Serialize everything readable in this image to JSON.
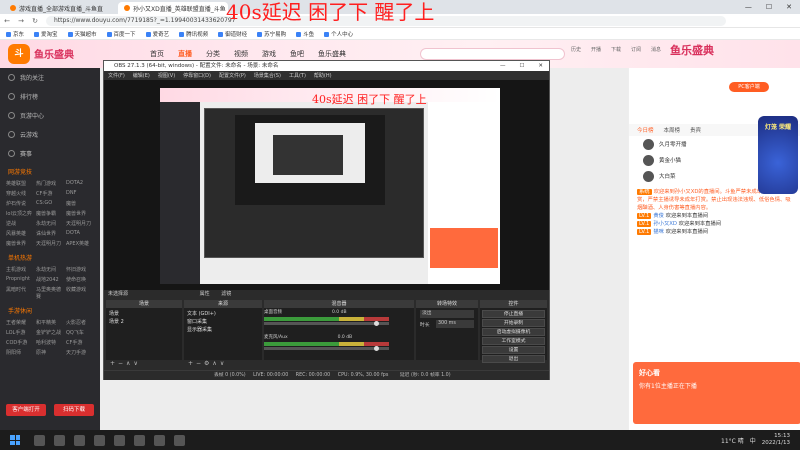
{
  "browser": {
    "tabs": [
      "游戏直播_全部游戏直播_斗鱼直",
      "孙小又XD直播_英雄联盟直播_斗鱼"
    ],
    "url": "https://www.douyu.com/7719185?_=1.19940031433620797",
    "bookmarks": [
      "京东",
      "爱淘宝",
      "天猫超市",
      "百度一下",
      "爱奇艺",
      "腾讯视频",
      "御道财经",
      "苏宁易购",
      "斗鱼",
      "个人中心"
    ]
  },
  "site": {
    "logo": "斗",
    "banner": "鱼乐盛典",
    "right_banner": "鱼乐盛典",
    "nav": [
      "首页",
      "直播",
      "分类",
      "视频",
      "游戏",
      "鱼吧",
      "鱼乐盛典"
    ],
    "icons": [
      "历史",
      "开播",
      "下载",
      "订阅",
      "消息",
      "客户端"
    ]
  },
  "sidebar": {
    "items": [
      "我的关注",
      "排行榜",
      "页游中心",
      "云游戏",
      "赛事"
    ],
    "sections": [
      {
        "title": "网游竞技",
        "games": [
          "英雄联盟",
          "热门游戏",
          "DOTA2",
          "穿越火线",
          "CF手游",
          "DNF",
          "炉石传说",
          "CS:GO",
          "魔兽",
          "lol云顶之弈",
          "魔兽争霸",
          "魔兽世界",
          "逆战",
          "永劫无间",
          "天涯明月刀",
          "风暴英雄",
          "诛仙世界",
          "DOTA",
          "魔兽世界",
          "天涯明月刀",
          "APEX英雄"
        ]
      },
      {
        "title": "单机热游",
        "games": [
          "主机游戏",
          "永劫无间",
          "怀旧游戏",
          "Propnight",
          "战地2042",
          "使命召唤",
          "黑暗时代",
          "马里奥奥德赛",
          "收藏游戏"
        ]
      },
      {
        "title": "手游休闲",
        "games": [
          "王者荣耀",
          "和平精英",
          "火影忍者",
          "LOL手游",
          "金铲铲之战",
          "QQ飞车",
          "COD手游",
          "哈利波特",
          "CF手游",
          "阴阳师",
          "原神",
          "天刀手游"
        ]
      }
    ],
    "buttons": [
      "客户端打开",
      "扫码下载"
    ]
  },
  "obs": {
    "title": "OBS 27.1.3 (64-bit, windows) - 配置文件: 未命名 - 场景: 未命名",
    "menu": [
      "文件(F)",
      "编辑(E)",
      "视图(V)",
      "停靠窗口(D)",
      "配置文件(P)",
      "场景集合(S)",
      "工具(T)",
      "帮助(H)"
    ],
    "window_controls": [
      "—",
      "☐",
      "✕"
    ],
    "overlay_text": "40s延迟 困了下 醒了上",
    "preview_overlay_small": "40s延迟 困了下 醒了上",
    "current_scene": "未选择源",
    "source_props": "属性",
    "filters": "滤镜",
    "scenes_title": "场景",
    "scenes": [
      "场景",
      "场景 2"
    ],
    "sources_title": "来源",
    "sources": [
      "文本 (GDI+)",
      "窗口采集",
      "显示器采集"
    ],
    "mixer_title": "混音器",
    "mixer": [
      {
        "name": "桌面音频",
        "db": "0.0 dB"
      },
      {
        "name": "麦克风/Aux",
        "db": "0.0 dB"
      }
    ],
    "trans_title": "转场特效",
    "trans_type": "淡出",
    "duration_label": "时长",
    "duration_value": "300 ms",
    "controls_title": "控件",
    "controls": [
      "停止直播",
      "开始录制",
      "启动虚拟摄像机",
      "工作室模式",
      "设置",
      "退出"
    ],
    "status": {
      "dropped": "丢帧 0 (0.0%)",
      "live": "LIVE: 00:00:00",
      "rec": "REC: 00:00:00",
      "cpu": "CPU: 0.9%, 30.00 fps",
      "rec_status": "延迟 (秒: 0.0 帧率 1.0)"
    }
  },
  "right_panel": {
    "pc_button": "PC客户端",
    "tabs": [
      "今日榜",
      "本周榜",
      "贵宾"
    ],
    "users": [
      "久月零开播",
      "黄金小猫",
      "大白菜"
    ],
    "chat": [
      {
        "tag": "系统",
        "text": "欢迎来到孙小又XD的直播间。斗鱼严禁未成年人直播或打赏，严禁主播诱导未成年打赏。禁止出现违法违规、低俗色情、吸烟酗酒、人身伤害等直播内容。"
      },
      {
        "tag": "LV.1",
        "name": "黄俊",
        "text": "欢迎来到本直播间"
      },
      {
        "tag": "LV.1",
        "name": "孙小又XD",
        "text": "欢迎来到本直播间"
      },
      {
        "tag": "LV.1",
        "name": "猫咪",
        "text": "欢迎来到本直播间"
      }
    ],
    "promo_title": "好心看",
    "promo_text": "你有1位主播正在下播",
    "gift_label": "灯笼 荣耀"
  },
  "taskbar": {
    "weather": "11°C 晴",
    "time": "15:13",
    "date": "2022/1/13",
    "lang": "中"
  }
}
